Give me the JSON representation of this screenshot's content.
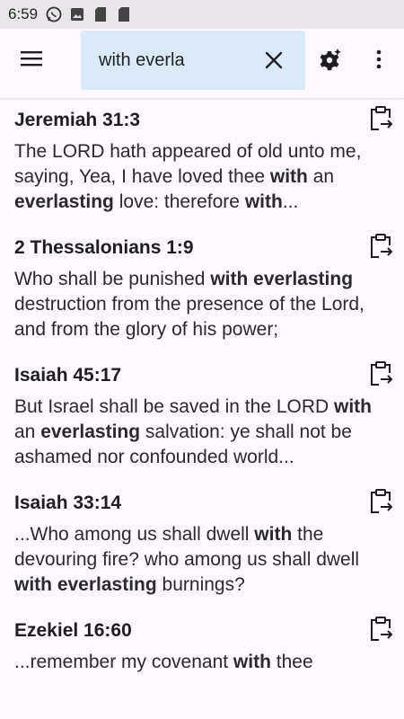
{
  "status": {
    "time": "6:59",
    "icons": [
      "whatsapp-icon",
      "image-icon",
      "sd-card-icon",
      "sd-card-icon"
    ]
  },
  "toolbar": {
    "menu_icon": "hamburger-menu-icon",
    "search": {
      "value": "with everla"
    },
    "clear_icon": "close-icon",
    "settings_icon": "search-settings-gear-icon",
    "more_icon": "more-vert-icon"
  },
  "results": [
    {
      "ref": "Jeremiah 31:3",
      "segments": [
        {
          "t": "The LORD hath appeared of old unto me, saying, Yea, I have loved thee ",
          "b": false
        },
        {
          "t": "with",
          "b": true
        },
        {
          "t": " an ",
          "b": false
        },
        {
          "t": "everlasting",
          "b": true
        },
        {
          "t": " love: therefore ",
          "b": false
        },
        {
          "t": "with",
          "b": true
        },
        {
          "t": "...",
          "b": false
        }
      ]
    },
    {
      "ref": "2 Thessalonians 1:9",
      "segments": [
        {
          "t": "Who shall be punished ",
          "b": false
        },
        {
          "t": "with everlasting",
          "b": true
        },
        {
          "t": " destruction from the presence of the Lord, and from the glory of his power;",
          "b": false
        }
      ]
    },
    {
      "ref": "Isaiah 45:17",
      "segments": [
        {
          "t": "But Israel shall be saved in the LORD ",
          "b": false
        },
        {
          "t": "with",
          "b": true
        },
        {
          "t": " an ",
          "b": false
        },
        {
          "t": "everlasting",
          "b": true
        },
        {
          "t": " salvation: ye shall not be ashamed nor confounded world...",
          "b": false
        }
      ]
    },
    {
      "ref": "Isaiah 33:14",
      "segments": [
        {
          "t": "...Who among us shall dwell ",
          "b": false
        },
        {
          "t": "with",
          "b": true
        },
        {
          "t": " the devouring fire? who among us shall dwell ",
          "b": false
        },
        {
          "t": "with everlasting",
          "b": true
        },
        {
          "t": " burnings?",
          "b": false
        }
      ]
    },
    {
      "ref": "Ezekiel 16:60",
      "segments": [
        {
          "t": "...remember my covenant ",
          "b": false
        },
        {
          "t": "with",
          "b": true
        },
        {
          "t": " thee",
          "b": false
        }
      ]
    }
  ],
  "colors": {
    "search_background": "#d9ebfa",
    "page_background": "#fcf8fd",
    "status_background": "#e9e6ea",
    "caret": "#1a73e8"
  }
}
